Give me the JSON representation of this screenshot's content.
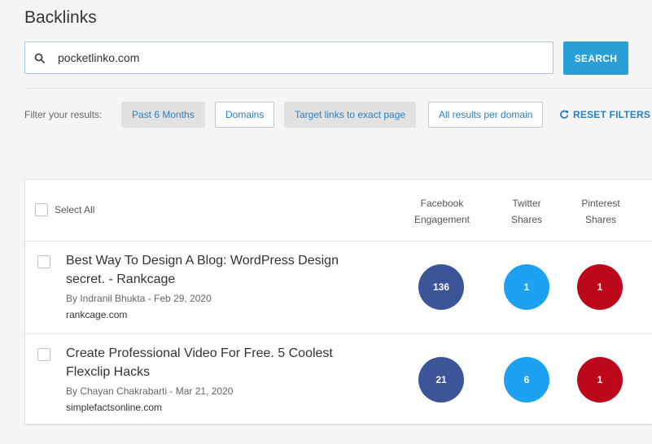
{
  "page": {
    "title": "Backlinks"
  },
  "search": {
    "value": "pocketlinko.com",
    "button_label": "SEARCH"
  },
  "filters": {
    "label": "Filter your results:",
    "chips": [
      {
        "label": "Past 6 Months",
        "active": true
      },
      {
        "label": "Domains",
        "active": false
      },
      {
        "label": "Target links to exact page",
        "active": true
      },
      {
        "label": "All results per domain",
        "active": false
      }
    ],
    "reset_label": "RESET FILTERS"
  },
  "table": {
    "select_all_label": "Select All",
    "columns": [
      {
        "line1": "Facebook",
        "line2": "Engagement"
      },
      {
        "line1": "Twitter",
        "line2": "Shares"
      },
      {
        "line1": "Pinterest",
        "line2": "Shares"
      }
    ],
    "rows": [
      {
        "title": "Best Way To Design A Blog: WordPress Design secret. - Rankcage",
        "meta": "By Indranil Bhukta - Feb 29, 2020",
        "domain": "rankcage.com",
        "facebook": "136",
        "twitter": "1",
        "pinterest": "1"
      },
      {
        "title": "Create Professional Video For Free. 5 Coolest Flexclip Hacks",
        "meta": "By Chayan Chakrabarti - Mar 21, 2020",
        "domain": "simplefactsonline.com",
        "facebook": "21",
        "twitter": "6",
        "pinterest": "1"
      }
    ]
  },
  "colors": {
    "accent": "#2a9fd8",
    "link": "#2a7fc2",
    "facebook": "#3b5598",
    "twitter": "#1da1f2",
    "pinterest": "#bd081c"
  }
}
